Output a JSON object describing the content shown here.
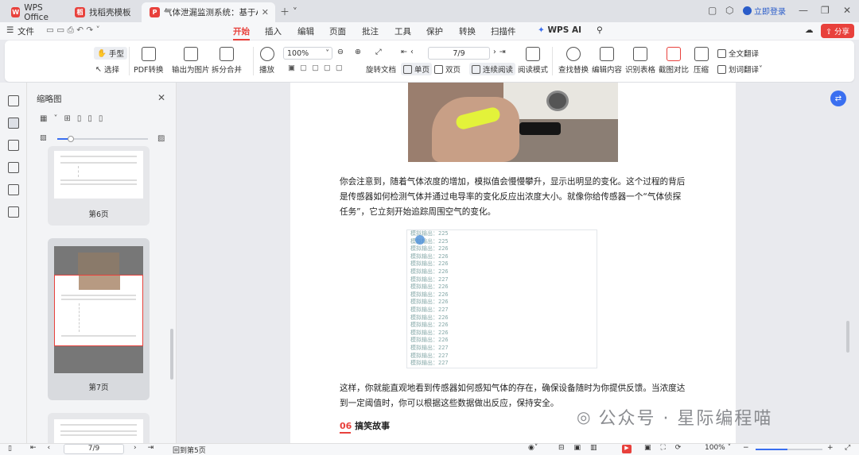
{
  "tabs": [
    {
      "label": "WPS Office"
    },
    {
      "label": "找稻壳模板"
    },
    {
      "label": "气体泄漏监测系统：基于Ard..."
    }
  ],
  "window": {
    "login_label": "立即登录",
    "share_label": "分享"
  },
  "menu": {
    "file_label": "文件",
    "items": [
      "开始",
      "插入",
      "编辑",
      "页面",
      "批注",
      "工具",
      "保护",
      "转换",
      "扫描件",
      "WPS AI"
    ]
  },
  "ribbon": {
    "hand_label": "手型",
    "select_label": "选择",
    "pdf_convert_label": "PDF转换",
    "export_image_label": "输出为图片",
    "split_merge_label": "拆分合并",
    "play_label": "播放",
    "zoom_value": "100%",
    "page_value": "7/9",
    "rotate_label": "旋转文档",
    "single_page_label": "单页",
    "double_page_label": "双页",
    "continuous_label": "连续阅读",
    "read_mode_label": "阅读模式",
    "find_replace_label": "查找替换",
    "edit_content_label": "编辑内容",
    "recognize_table_label": "识别表格",
    "screenshot_compare_label": "截图对比",
    "compress_label": "压缩",
    "full_translate_label": "全文翻译",
    "word_translate_label": "划词翻译"
  },
  "thumbs": {
    "title": "缩略图",
    "page6_label": "第6页",
    "page7_label": "第7页"
  },
  "document": {
    "para1": "你会注意到，随着气体浓度的增加，模拟值会慢慢攀升，显示出明显的变化。这个过程的背后是传感器如何检测气体并通过电导率的变化反应出浓度大小。就像你给传感器一个“气体侦探任务”，它立刻开始追踪周围空气的变化。",
    "output_lines": [
      "模拟输出：225",
      "模拟输出：225",
      "模拟输出：226",
      "模拟输出：226",
      "模拟输出：226",
      "模拟输出：226",
      "模拟输出：227",
      "模拟输出：226",
      "模拟输出：226",
      "模拟输出：226",
      "模拟输出：227",
      "模拟输出：226",
      "模拟输出：226",
      "模拟输出：226",
      "模拟输出：226",
      "模拟输出：227",
      "模拟输出：227",
      "模拟输出：227"
    ],
    "para2": "这样，你就能直观地看到传感器如何感知气体的存在，确保设备随时为你提供反馈。当浓度达到一定阈值时，你可以根据这些数据做出反应，保持安全。",
    "section_num": "06",
    "section_title": "搞笑故事",
    "watermark": "公众号 · 星际编程喵"
  },
  "status": {
    "page_value": "7/9",
    "back_label": "回到第5页",
    "zoom_value": "100%"
  },
  "colors": {
    "accent": "#e8413c",
    "ribbon_bg": "#ffffff"
  }
}
